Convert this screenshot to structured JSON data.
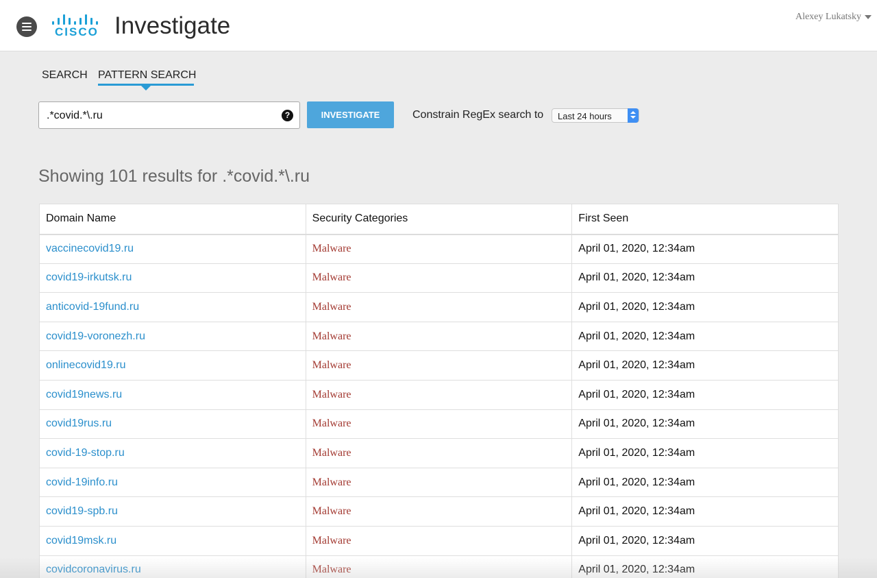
{
  "header": {
    "logo_text": "CISCO",
    "app_title": "Investigate",
    "user_name": "Alexey Lukatsky"
  },
  "tabs": [
    {
      "label": "SEARCH",
      "active": false
    },
    {
      "label": "PATTERN SEARCH",
      "active": true
    }
  ],
  "search": {
    "value": ".*covid.*\\.ru",
    "help_glyph": "?",
    "button_label": "INVESTIGATE",
    "constrain_label": "Constrain RegEx search to",
    "time_range": "Last 24 hours"
  },
  "results": {
    "heading": "Showing 101 results for .*covid.*\\.ru",
    "columns": [
      "Domain Name",
      "Security Categories",
      "First Seen"
    ],
    "rows": [
      {
        "domain": "vaccinecovid19.ru",
        "category": "Malware",
        "first_seen": "April 01, 2020, 12:34am"
      },
      {
        "domain": "covid19-irkutsk.ru",
        "category": "Malware",
        "first_seen": "April 01, 2020, 12:34am"
      },
      {
        "domain": "anticovid-19fund.ru",
        "category": "Malware",
        "first_seen": "April 01, 2020, 12:34am"
      },
      {
        "domain": "covid19-voronezh.ru",
        "category": "Malware",
        "first_seen": "April 01, 2020, 12:34am"
      },
      {
        "domain": "onlinecovid19.ru",
        "category": "Malware",
        "first_seen": "April 01, 2020, 12:34am"
      },
      {
        "domain": "covid19news.ru",
        "category": "Malware",
        "first_seen": "April 01, 2020, 12:34am"
      },
      {
        "domain": "covid19rus.ru",
        "category": "Malware",
        "first_seen": "April 01, 2020, 12:34am"
      },
      {
        "domain": "covid-19-stop.ru",
        "category": "Malware",
        "first_seen": "April 01, 2020, 12:34am"
      },
      {
        "domain": "covid-19info.ru",
        "category": "Malware",
        "first_seen": "April 01, 2020, 12:34am"
      },
      {
        "domain": "covid19-spb.ru",
        "category": "Malware",
        "first_seen": "April 01, 2020, 12:34am"
      },
      {
        "domain": "covid19msk.ru",
        "category": "Malware",
        "first_seen": "April 01, 2020, 12:34am"
      },
      {
        "domain": "covidcoronavirus.ru",
        "category": "Malware",
        "first_seen": "April 01, 2020, 12:34am"
      }
    ]
  },
  "colors": {
    "accent": "#2a9bd5",
    "button": "#4ea6dc",
    "link": "#2b8fcc",
    "malware": "#a33a32",
    "brand": "#1ba0d7"
  }
}
